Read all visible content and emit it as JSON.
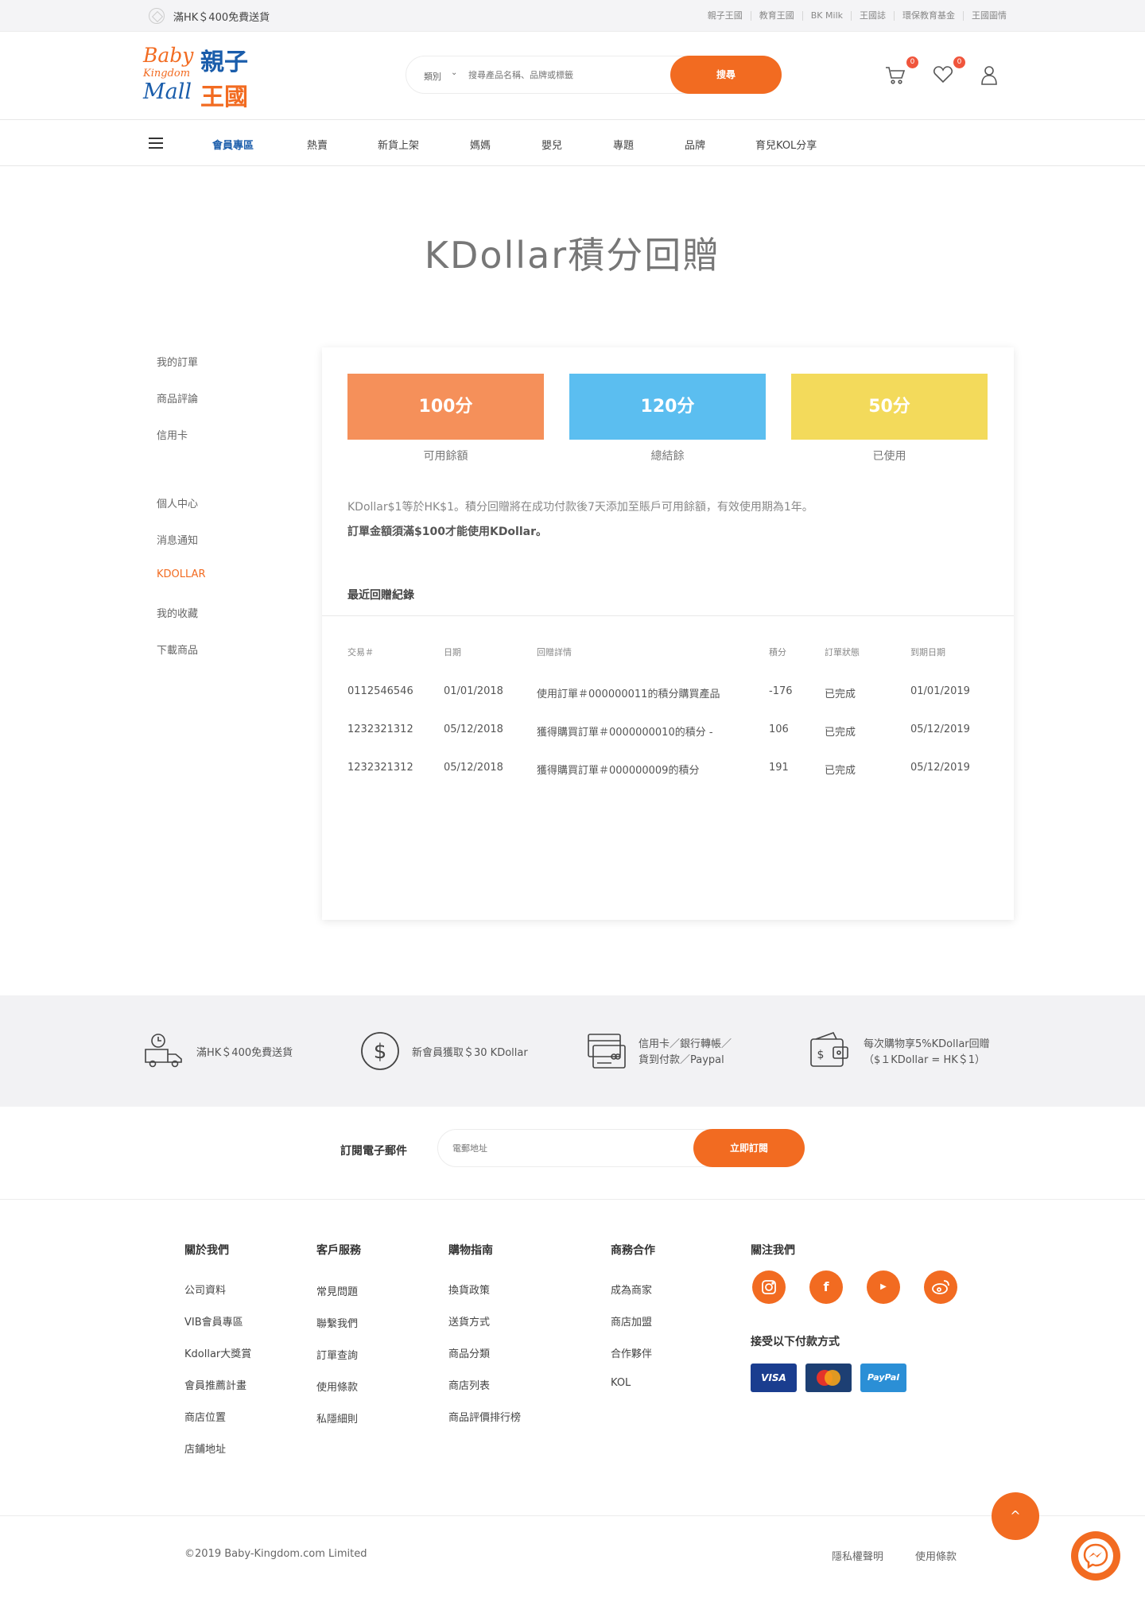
{
  "topbar": {
    "promo": "滿HK＄400免費送貨",
    "links": [
      "親子王國",
      "教育王國",
      "BK Milk",
      "王國誌",
      "環保教育基金",
      "王國圖情"
    ]
  },
  "header": {
    "logo": {
      "en1": "Baby",
      "en2": "Kingdom",
      "en3": "Mall",
      "zh1": "親子",
      "zh2": "王國"
    },
    "search": {
      "category": "類別",
      "placeholder": "搜尋產品名稱、品牌或標籤",
      "button": "搜尋"
    },
    "cart_count": "0",
    "wishlist_count": "0",
    "icons": [
      "cart-icon",
      "heart-icon",
      "user-icon"
    ]
  },
  "nav": {
    "items": [
      "會員專區",
      "熱賣",
      "新貨上架",
      "媽媽",
      "嬰兒",
      "專題",
      "品牌",
      "育兒KOL分享"
    ]
  },
  "page": {
    "title": "KDollar積分回贈"
  },
  "sidebar": {
    "group1": [
      "我的訂單",
      "商品評論",
      "信用卡"
    ],
    "group2": [
      "個人中心",
      "消息通知",
      "KDOLLAR",
      "我的收藏",
      "下載商品"
    ]
  },
  "points": {
    "available": {
      "value": "100分",
      "label": "可用餘額",
      "color": "#f5905a"
    },
    "total": {
      "value": "120分",
      "label": "總結餘",
      "color": "#5bbef0"
    },
    "used": {
      "value": "50分",
      "label": "已使用",
      "color": "#f3da5b"
    }
  },
  "notes": {
    "line1": "KDollar$1等於HK$1。積分回贈將在成功付款後7天添加至賬戶可用餘額，有效使用期為1年。",
    "line2": "訂單金額須滿$100才能使用KDollar。"
  },
  "records": {
    "title": "最近回贈紀錄",
    "headers": [
      "交易＃",
      "日期",
      "回贈詳情",
      "積分",
      "訂單狀態",
      "到期日期"
    ],
    "rows": [
      [
        "0112546546",
        "01/01/2018",
        "使用訂單＃000000011的積分購買產品",
        "-176",
        "已完成",
        "01/01/2019"
      ],
      [
        "1232321312",
        "05/12/2018",
        "獲得購買訂單＃0000000010的積分 -",
        "106",
        "已完成",
        "05/12/2019"
      ],
      [
        "1232321312",
        "05/12/2018",
        "獲得購買訂單＃000000009的積分",
        "191",
        "已完成",
        "05/12/2019"
      ]
    ]
  },
  "features": [
    {
      "icon": "delivery-truck-icon",
      "text": "滿HK＄400免費送貨"
    },
    {
      "icon": "dollar-icon",
      "text": "新會員獲取＄30 KDollar"
    },
    {
      "icon": "credit-card-icon",
      "text": "信用卡／銀行轉帳／",
      "text2": "貨到付款／Paypal"
    },
    {
      "icon": "wallet-icon",
      "text": "每次購物享5%KDollar回贈",
      "text2": "（$１KDollar = HK＄1）"
    }
  ],
  "newsletter": {
    "label": "訂閱電子郵件",
    "placeholder": "電郵地址",
    "button": "立即訂閱"
  },
  "footer": {
    "about": {
      "title": "關於我們",
      "links": [
        "公司資料",
        "VIB會員專區",
        "Kdollar大獎賞",
        "會員推薦計畫",
        "商店位置",
        "店鋪地址"
      ]
    },
    "service": {
      "title": "客戶服務",
      "links": [
        "常見問題",
        "聯繫我們",
        "訂單查詢",
        "使用條款",
        "私隱細則"
      ]
    },
    "guide": {
      "title": "購物指南",
      "links": [
        "換貨政策",
        "送貨方式",
        "商品分類",
        "商店列表",
        "商品評價排行榜"
      ]
    },
    "business": {
      "title": "商務合作",
      "links": [
        "成為商家",
        "商店加盟",
        "合作夥伴",
        "KOL"
      ]
    },
    "follow": {
      "title": "關注我們",
      "payment_title": "接受以下付款方式"
    },
    "social": [
      "instagram-icon",
      "facebook-icon",
      "youtube-icon",
      "weibo-icon"
    ],
    "payments": {
      "visa": "VISA",
      "mastercard": "MasterCard",
      "paypal": "PayPal"
    },
    "copyright": "©2019 Baby-Kingdom.com Limited",
    "bottom_links": [
      "隱私權聲明",
      "使用條款"
    ]
  },
  "colors": {
    "accent": "#f26b21",
    "brand_blue": "#1a5dab"
  }
}
